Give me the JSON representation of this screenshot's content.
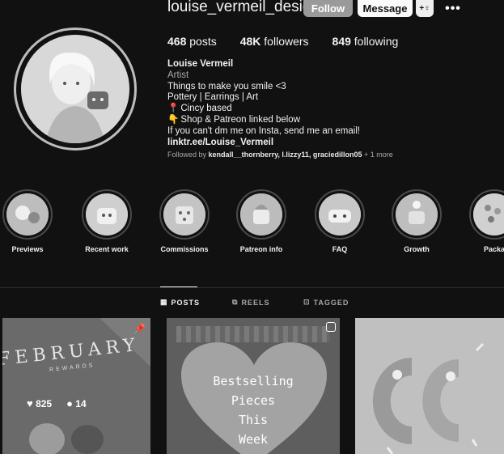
{
  "profile": {
    "username": "louise_vermeil_designs",
    "buttons": {
      "follow": "Follow",
      "message": "Message",
      "suggest_icon": "add-user-icon",
      "more": "•••"
    },
    "stats": [
      {
        "value": "468",
        "label": "posts"
      },
      {
        "value": "48K",
        "label": "followers"
      },
      {
        "value": "849",
        "label": "following"
      }
    ],
    "bio": {
      "name": "Louise Vermeil",
      "category": "Artist",
      "lines": [
        "Things to make you smile <3",
        "Pottery | Earrings | Art",
        "Cincy based",
        "Shop & Patreon linked below",
        "If you can't dm me on Insta, send me an email!"
      ],
      "link": "linktr.ee/Louise_Vermeil"
    },
    "followed_by": {
      "prefix": "Followed by",
      "names": "kendall__thornberry, l.lizzy11, graciedillon05",
      "suffix": "+ 1 more"
    }
  },
  "highlights": [
    {
      "label": "Previews"
    },
    {
      "label": "Recent work"
    },
    {
      "label": "Commissions"
    },
    {
      "label": "Patreon info"
    },
    {
      "label": "FAQ"
    },
    {
      "label": "Growth"
    },
    {
      "label": "Packag"
    }
  ],
  "tabs": [
    {
      "label": "POSTS",
      "icon": "grid-icon",
      "active": true
    },
    {
      "label": "REELS",
      "icon": "reels-icon",
      "active": false
    },
    {
      "label": "TAGGED",
      "icon": "tagged-icon",
      "active": false
    }
  ],
  "posts": [
    {
      "title": "FEBRUARY",
      "subtitle": "REWARDS",
      "likes": "825",
      "comments": "14",
      "pinned": true
    },
    {
      "caption_lines": [
        "Bestselling",
        "Pieces",
        "This",
        "Week"
      ],
      "type": "reel"
    },
    {
      "type": "image"
    }
  ]
}
